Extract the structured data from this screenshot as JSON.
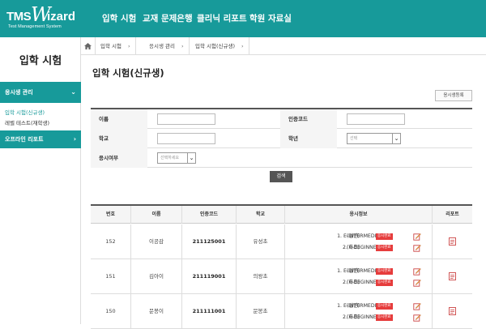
{
  "header": {
    "logo_tms": "TMS",
    "logo_w": "W",
    "logo_izard": "izard",
    "logo_sub": "Test Management System",
    "nav": [
      "입학 시험",
      "교재 문제은행",
      "클리닉 리포트",
      "학원 자료실"
    ],
    "bg_color": "#179a9a"
  },
  "sidebar": {
    "title": "입학 시험",
    "menu1": "응시생 관리",
    "sub_active": "입학 시험(신규생)",
    "sub_other": "레벨 테스트(재학생)",
    "menu2": "오프라인 리포트"
  },
  "breadcrumb": {
    "home_icon": "home-icon",
    "items": [
      "입학 시험",
      "응시생 관리",
      "입학 시험(신규생)"
    ]
  },
  "page": {
    "title": "입학 시험(신규생)",
    "register_button": "응시생등록"
  },
  "form": {
    "name_label": "이름",
    "code_label": "인증코드",
    "school_label": "학교",
    "grade_label": "학년",
    "grade_select": "선택",
    "status_label": "응시여부",
    "status_select": "선택하세요",
    "search_button": "검색"
  },
  "table": {
    "headers": [
      "번호",
      "이름",
      "인증코드",
      "학교",
      "응시정보",
      "리포트"
    ],
    "badge_label": "응시완료",
    "rows": [
      {
        "no": "152",
        "name": "이공감",
        "code": "211125001",
        "school": "유성초",
        "exams": [
          {
            "label": "1. E-INTERMEDIATE",
            "type": "(일반)"
          },
          {
            "label": "2. E-BEGINNER",
            "type": "(하프)"
          }
        ]
      },
      {
        "no": "151",
        "name": "김아이",
        "code": "211119001",
        "school": "의왕초",
        "exams": [
          {
            "label": "1. E-INTERMEDIATE",
            "type": "(일반)"
          },
          {
            "label": "2. E-BEGINNER",
            "type": "(하프)"
          }
        ]
      },
      {
        "no": "150",
        "name": "문봉이",
        "code": "211111001",
        "school": "문봉초",
        "exams": [
          {
            "label": "1. E-INTERMEDIATE",
            "type": "(일반)"
          },
          {
            "label": "2. E-BEGINNER",
            "type": "(하프)"
          }
        ]
      }
    ]
  }
}
